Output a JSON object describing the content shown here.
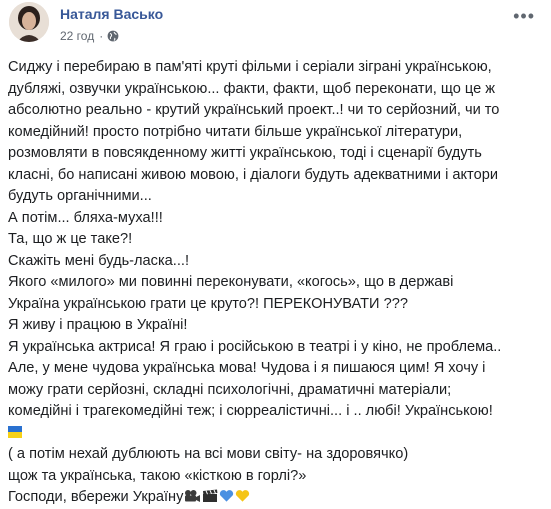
{
  "header": {
    "author": "Наталя Васько",
    "time": "22 год",
    "dot": "·",
    "more": "•••"
  },
  "post": {
    "lines": [
      "Сиджу і перебираю в пам'яті круті фільми і серіали зіграні українською,",
      "дубляжі, озвучки українською... факти, факти, щоб переконати, що це ж",
      "абсолютно реально - крутий український проект..! чи то серйозний, чи то",
      "комедійний! просто потрібно читати більше української літератури,",
      "розмовляти в повсякденному житті українською, тоді і сценарії будуть",
      "класні, бо написані живою мовою, і діалоги будуть адекватними і актори",
      "будуть органічними...",
      "А потім... бляха-муха!!!",
      "Та, що ж це таке?!",
      "Скажіть мені будь-ласка...!",
      "Якого «милого» ми повинні переконувати, «когось», що в державі",
      "Україна українською грати це круто?! ПЕРЕКОНУВАТИ ???",
      "Я живу і працюю в Україні!",
      "Я українська актриса! Я граю і російською в театрі і у кіно, не проблема..",
      "Але, у мене чудова українська мова! Чудова і я пишаюся цим! Я хочу і",
      "можу грати серйозні, складні психологічні, драматичні матеріали;",
      "комедійні і трагекомедійні теж; і сюрреалістичні... і .. любі! Українською!"
    ],
    "line_after_flag_1": "( а потім нехай дублюють на всі мови світу- на здоровячко)",
    "line_after_flag_2": "щож та українська, такою «кісткою в горлі?»",
    "last_line": "Господи, вбережи Україну",
    "emojis": [
      "flag-ukraine-icon",
      "movie-camera-icon",
      "clapper-board-icon",
      "blue-heart-icon",
      "yellow-heart-icon"
    ],
    "colors": {
      "link": "#385898",
      "blue": "#2a71d0",
      "yellow": "#f7d117",
      "meta": "#606770"
    }
  }
}
